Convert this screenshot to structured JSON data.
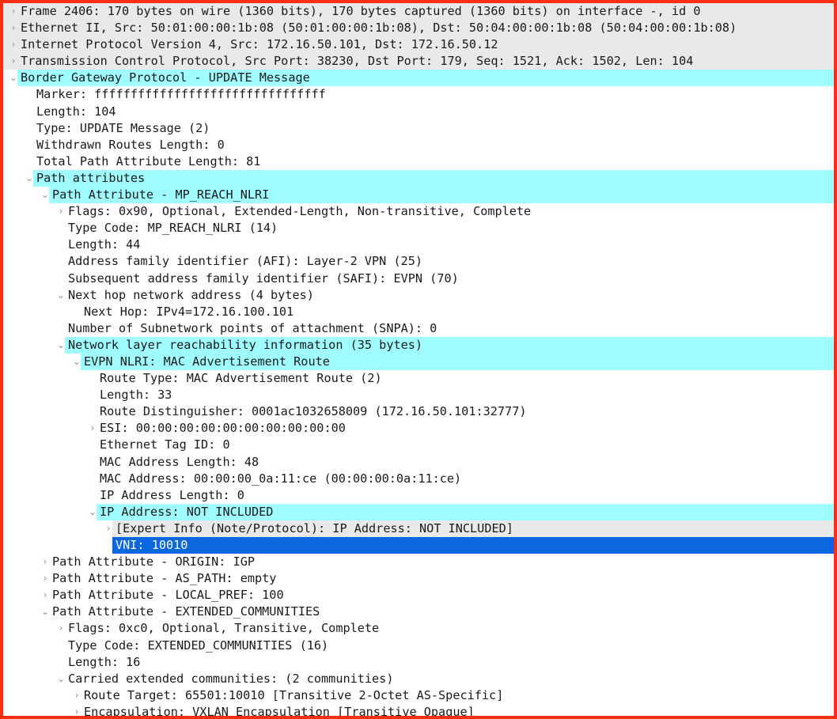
{
  "pane": {
    "name": "packet-details",
    "border_color": "#fa2e14",
    "highlight_color": "#9ffcff",
    "selection_color": "#0b67e0",
    "generated_row_color": "#e9e9e9"
  },
  "rows": [
    {
      "indent": 0,
      "twisty": "closed",
      "bg": "gray",
      "text": "Frame 2406: 170 bytes on wire (1360 bits), 170 bytes captured (1360 bits) on interface -, id 0"
    },
    {
      "indent": 0,
      "twisty": "closed",
      "bg": "gray",
      "text": "Ethernet II, Src: 50:01:00:00:1b:08 (50:01:00:00:1b:08), Dst: 50:04:00:00:1b:08 (50:04:00:00:1b:08)"
    },
    {
      "indent": 0,
      "twisty": "closed",
      "bg": "gray",
      "text": "Internet Protocol Version 4, Src: 172.16.50.101, Dst: 172.16.50.12"
    },
    {
      "indent": 0,
      "twisty": "closed",
      "bg": "gray",
      "text": "Transmission Control Protocol, Src Port: 38230, Dst Port: 179, Seq: 1521, Ack: 1502, Len: 104"
    },
    {
      "indent": 0,
      "twisty": "open",
      "bg": "cyan",
      "text": "Border Gateway Protocol - UPDATE Message"
    },
    {
      "indent": 1,
      "twisty": "none",
      "bg": "white",
      "text": "Marker: ffffffffffffffffffffffffffffffff"
    },
    {
      "indent": 1,
      "twisty": "none",
      "bg": "white",
      "text": "Length: 104"
    },
    {
      "indent": 1,
      "twisty": "none",
      "bg": "white",
      "text": "Type: UPDATE Message (2)"
    },
    {
      "indent": 1,
      "twisty": "none",
      "bg": "white",
      "text": "Withdrawn Routes Length: 0"
    },
    {
      "indent": 1,
      "twisty": "none",
      "bg": "white",
      "text": "Total Path Attribute Length: 81"
    },
    {
      "indent": 1,
      "twisty": "open",
      "bg": "cyan",
      "text": "Path attributes"
    },
    {
      "indent": 2,
      "twisty": "open",
      "bg": "cyan",
      "text": "Path Attribute - MP_REACH_NLRI"
    },
    {
      "indent": 3,
      "twisty": "closed",
      "bg": "white",
      "text": "Flags: 0x90, Optional, Extended-Length, Non-transitive, Complete"
    },
    {
      "indent": 3,
      "twisty": "none",
      "bg": "white",
      "text": "Type Code: MP_REACH_NLRI (14)"
    },
    {
      "indent": 3,
      "twisty": "none",
      "bg": "white",
      "text": "Length: 44"
    },
    {
      "indent": 3,
      "twisty": "none",
      "bg": "white",
      "text": "Address family identifier (AFI): Layer-2 VPN (25)"
    },
    {
      "indent": 3,
      "twisty": "none",
      "bg": "white",
      "text": "Subsequent address family identifier (SAFI): EVPN (70)"
    },
    {
      "indent": 3,
      "twisty": "open",
      "bg": "white",
      "text": "Next hop network address (4 bytes)"
    },
    {
      "indent": 4,
      "twisty": "none",
      "bg": "white",
      "text": "Next Hop: IPv4=172.16.100.101"
    },
    {
      "indent": 3,
      "twisty": "none",
      "bg": "white",
      "text": "Number of Subnetwork points of attachment (SNPA): 0"
    },
    {
      "indent": 3,
      "twisty": "open",
      "bg": "cyan",
      "text": "Network layer reachability information (35 bytes)"
    },
    {
      "indent": 4,
      "twisty": "open",
      "bg": "cyan",
      "text": "EVPN NLRI: MAC Advertisement Route"
    },
    {
      "indent": 5,
      "twisty": "none",
      "bg": "white",
      "text": "Route Type: MAC Advertisement Route (2)"
    },
    {
      "indent": 5,
      "twisty": "none",
      "bg": "white",
      "text": "Length: 33"
    },
    {
      "indent": 5,
      "twisty": "none",
      "bg": "white",
      "text": "Route Distinguisher: 0001ac1032658009 (172.16.50.101:32777)"
    },
    {
      "indent": 5,
      "twisty": "closed",
      "bg": "white",
      "text": "ESI: 00:00:00:00:00:00:00:00:00:00"
    },
    {
      "indent": 5,
      "twisty": "none",
      "bg": "white",
      "text": "Ethernet Tag ID: 0"
    },
    {
      "indent": 5,
      "twisty": "none",
      "bg": "white",
      "text": "MAC Address Length: 48"
    },
    {
      "indent": 5,
      "twisty": "none",
      "bg": "white",
      "text": "MAC Address: 00:00:00_0a:11:ce (00:00:00:0a:11:ce)"
    },
    {
      "indent": 5,
      "twisty": "none",
      "bg": "white",
      "text": "IP Address Length: 0"
    },
    {
      "indent": 5,
      "twisty": "open",
      "bg": "cyan",
      "text": "IP Address: NOT INCLUDED"
    },
    {
      "indent": 6,
      "twisty": "closed",
      "bg": "gray2",
      "text": "[Expert Info (Note/Protocol): IP Address: NOT INCLUDED]"
    },
    {
      "indent": 6,
      "twisty": "none",
      "bg": "select",
      "text": "VNI: 10010"
    },
    {
      "indent": 2,
      "twisty": "closed",
      "bg": "white",
      "text": "Path Attribute - ORIGIN: IGP"
    },
    {
      "indent": 2,
      "twisty": "closed",
      "bg": "white",
      "text": "Path Attribute - AS_PATH: empty"
    },
    {
      "indent": 2,
      "twisty": "closed",
      "bg": "white",
      "text": "Path Attribute - LOCAL_PREF: 100"
    },
    {
      "indent": 2,
      "twisty": "open",
      "bg": "white",
      "text": "Path Attribute - EXTENDED_COMMUNITIES"
    },
    {
      "indent": 3,
      "twisty": "closed",
      "bg": "white",
      "text": "Flags: 0xc0, Optional, Transitive, Complete"
    },
    {
      "indent": 3,
      "twisty": "none",
      "bg": "white",
      "text": "Type Code: EXTENDED_COMMUNITIES (16)"
    },
    {
      "indent": 3,
      "twisty": "none",
      "bg": "white",
      "text": "Length: 16"
    },
    {
      "indent": 3,
      "twisty": "open",
      "bg": "white",
      "text": "Carried extended communities: (2 communities)"
    },
    {
      "indent": 4,
      "twisty": "closed",
      "bg": "white",
      "text": "Route Target: 65501:10010 [Transitive 2-Octet AS-Specific]"
    },
    {
      "indent": 4,
      "twisty": "closed",
      "bg": "white",
      "text": "Encapsulation: VXLAN Encapsulation [Transitive Opaque]"
    }
  ]
}
